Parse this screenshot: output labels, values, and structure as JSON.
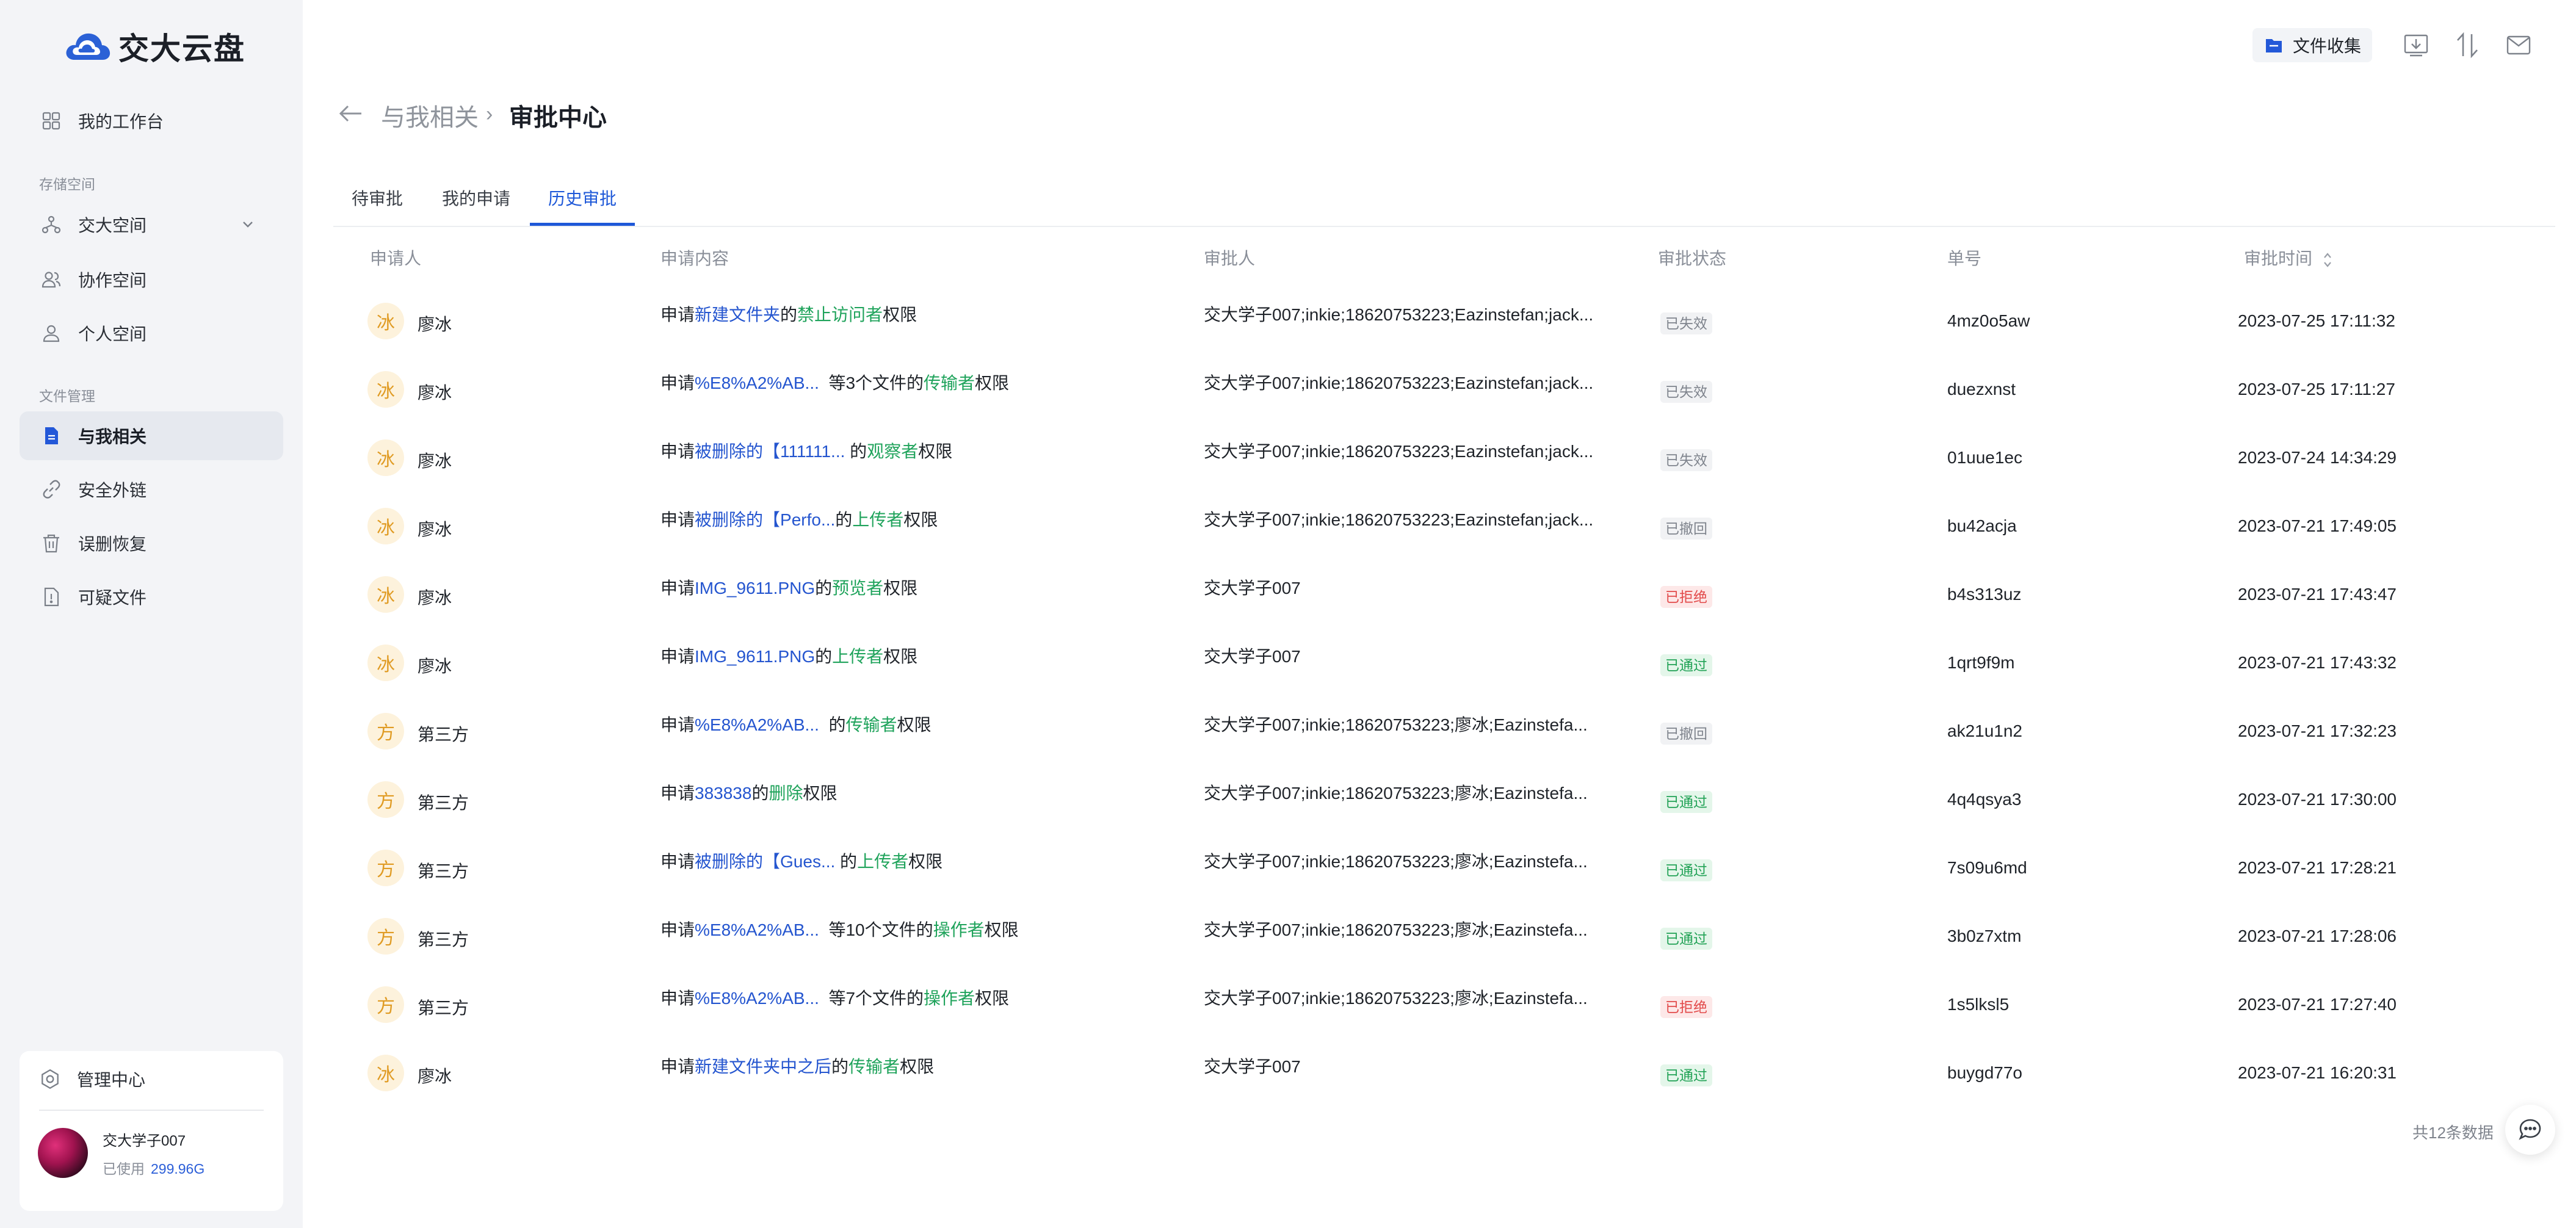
{
  "app": {
    "title": "交大云盘"
  },
  "sidebar": {
    "workbench": "我的工作台",
    "storage_label": "存储空间",
    "storage_items": [
      "交大空间",
      "协作空间",
      "个人空间"
    ],
    "files_label": "文件管理",
    "file_items": [
      "与我相关",
      "安全外链",
      "误删恢复",
      "可疑文件"
    ],
    "admin": "管理中心",
    "user": {
      "name": "交大学子007",
      "usage_label": "已使用",
      "usage_value": "299.96G"
    }
  },
  "toolbar": {
    "collect_label": "文件收集"
  },
  "header": {
    "parent": "与我相关",
    "separator": "›",
    "current": "审批中心"
  },
  "tabs": [
    "待审批",
    "我的申请",
    "历史审批"
  ],
  "active_tab": 2,
  "table": {
    "columns": [
      "申请人",
      "申请内容",
      "审批人",
      "审批状态",
      "单号",
      "审批时间"
    ],
    "rows": [
      {
        "avatar": "冰",
        "applicant": "廖冰",
        "c1": "申请",
        "target": "新建文件夹",
        "c2": "的",
        "role": "禁止访问者",
        "c3": "权限",
        "approver": "交大学子007;inkie;18620753223;Eazinstefan;jack...",
        "status": "已失效",
        "status_type": "gray",
        "order": "4mz0o5aw",
        "time": "2023-07-25 17:11:32"
      },
      {
        "avatar": "冰",
        "applicant": "廖冰",
        "c1": "申请",
        "target": "%E8%A2%AB...",
        "c2": "  等3个文件的",
        "role": "传输者",
        "c3": "权限",
        "approver": "交大学子007;inkie;18620753223;Eazinstefan;jack...",
        "status": "已失效",
        "status_type": "gray",
        "order": "duezxnst",
        "time": "2023-07-25 17:11:27"
      },
      {
        "avatar": "冰",
        "applicant": "廖冰",
        "c1": "申请",
        "target": "被删除的【111111...",
        "c2": " 的",
        "role": "观察者",
        "c3": "权限",
        "approver": "交大学子007;inkie;18620753223;Eazinstefan;jack...",
        "status": "已失效",
        "status_type": "gray",
        "order": "01uue1ec",
        "time": "2023-07-24 14:34:29"
      },
      {
        "avatar": "冰",
        "applicant": "廖冰",
        "c1": "申请",
        "target": "被删除的【Perfo...",
        "c2": "的",
        "role": "上传者",
        "c3": "权限",
        "approver": "交大学子007;inkie;18620753223;Eazinstefan;jack...",
        "status": "已撤回",
        "status_type": "gray",
        "order": "bu42acja",
        "time": "2023-07-21 17:49:05"
      },
      {
        "avatar": "冰",
        "applicant": "廖冰",
        "c1": "申请",
        "target": "IMG_9611.PNG",
        "c2": "的",
        "role": "预览者",
        "c3": "权限",
        "approver": "交大学子007",
        "status": "已拒绝",
        "status_type": "red",
        "order": "b4s313uz",
        "time": "2023-07-21 17:43:47"
      },
      {
        "avatar": "冰",
        "applicant": "廖冰",
        "c1": "申请",
        "target": "IMG_9611.PNG",
        "c2": "的",
        "role": "上传者",
        "c3": "权限",
        "approver": "交大学子007",
        "status": "已通过",
        "status_type": "green",
        "order": "1qrt9f9m",
        "time": "2023-07-21 17:43:32"
      },
      {
        "avatar": "方",
        "applicant": "第三方",
        "c1": "申请",
        "target": "%E8%A2%AB...",
        "c2": "  的",
        "role": "传输者",
        "c3": "权限",
        "approver": "交大学子007;inkie;18620753223;廖冰;Eazinstefa...",
        "status": "已撤回",
        "status_type": "gray",
        "order": "ak21u1n2",
        "time": "2023-07-21 17:32:23"
      },
      {
        "avatar": "方",
        "applicant": "第三方",
        "c1": "申请",
        "target": "383838",
        "c2": "的",
        "role": "删除",
        "c3": "权限",
        "approver": "交大学子007;inkie;18620753223;廖冰;Eazinstefa...",
        "status": "已通过",
        "status_type": "green",
        "order": "4q4qsya3",
        "time": "2023-07-21 17:30:00"
      },
      {
        "avatar": "方",
        "applicant": "第三方",
        "c1": "申请",
        "target": "被删除的【Gues...",
        "c2": " 的",
        "role": "上传者",
        "c3": "权限",
        "approver": "交大学子007;inkie;18620753223;廖冰;Eazinstefa...",
        "status": "已通过",
        "status_type": "green",
        "order": "7s09u6md",
        "time": "2023-07-21 17:28:21"
      },
      {
        "avatar": "方",
        "applicant": "第三方",
        "c1": "申请",
        "target": "%E8%A2%AB...",
        "c2": "  等10个文件的",
        "role": "操作者",
        "c3": "权限",
        "approver": "交大学子007;inkie;18620753223;廖冰;Eazinstefa...",
        "status": "已通过",
        "status_type": "green",
        "order": "3b0z7xtm",
        "time": "2023-07-21 17:28:06"
      },
      {
        "avatar": "方",
        "applicant": "第三方",
        "c1": "申请",
        "target": "%E8%A2%AB...",
        "c2": "  等7个文件的",
        "role": "操作者",
        "c3": "权限",
        "approver": "交大学子007;inkie;18620753223;廖冰;Eazinstefa...",
        "status": "已拒绝",
        "status_type": "red",
        "order": "1s5lksl5",
        "time": "2023-07-21 17:27:40"
      },
      {
        "avatar": "冰",
        "applicant": "廖冰",
        "c1": "申请",
        "target": "新建文件夹中之后",
        "c2": "的",
        "role": "传输者",
        "c3": "权限",
        "approver": "交大学子007",
        "status": "已通过",
        "status_type": "green",
        "order": "buygd77o",
        "time": "2023-07-21 16:20:31"
      }
    ]
  },
  "footer": {
    "total": "共12条数据"
  },
  "colors": {
    "accent": "#1e58d8",
    "link_blue": "#2455cf",
    "role_green": "#1fa35b",
    "status_red": "#e24b4b",
    "sidebar_bg": "#f3f4f7"
  },
  "icons": [
    "cloud-logo-icon",
    "grid-icon",
    "org-icon",
    "chevron-down-icon",
    "team-icon",
    "person-icon",
    "document-icon",
    "link-icon",
    "trash-icon",
    "suspicious-file-icon",
    "gear-icon",
    "folder-icon",
    "download-icon",
    "transfer-icon",
    "mail-icon",
    "back-arrow-icon",
    "sort-icon",
    "chat-icon"
  ]
}
